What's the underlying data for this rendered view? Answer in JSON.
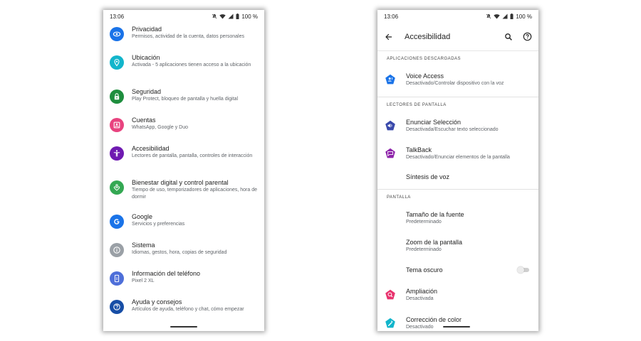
{
  "left_phone": {
    "status": {
      "time": "13:06",
      "battery": "100 %"
    },
    "items": [
      {
        "title": "Privacidad",
        "summary": "Permisos, actividad de la cuenta, datos personales",
        "color": "#1a73e8",
        "icon": "eye-icon"
      },
      {
        "title": "Ubicación",
        "summary": "Activada - 5 aplicaciones tienen acceso a la ubicación",
        "color": "#12b5cb",
        "icon": "location-pin-icon"
      },
      {
        "title": "Seguridad",
        "summary": "Play Protect, bloqueo de pantalla y huella digital",
        "color": "#1e8e3e",
        "icon": "lock-icon"
      },
      {
        "title": "Cuentas",
        "summary": "WhatsApp, Google y Duo",
        "color": "#e8437f",
        "icon": "account-card-icon"
      },
      {
        "title": "Accesibilidad",
        "summary": "Lectores de pantalla, pantalla, controles de interacción",
        "color": "#6f1ab1",
        "icon": "accessibility-person-icon"
      },
      {
        "title": "Bienestar digital y control parental",
        "summary": "Tiempo de uso, temporizadores de aplicaciones, hora de dormir",
        "color": "#34a853",
        "icon": "wellbeing-heart-icon"
      },
      {
        "title": "Google",
        "summary": "Servicios y preferencias",
        "color": "#1a73e8",
        "icon": "google-g-icon"
      },
      {
        "title": "Sistema",
        "summary": "Idiomas, gestos, hora, copias de seguridad",
        "color": "#9aa0a6",
        "icon": "info-icon"
      },
      {
        "title": "Información del teléfono",
        "summary": "Pixel 2 XL",
        "color": "#4e6fd9",
        "icon": "phone-info-icon"
      },
      {
        "title": "Ayuda y consejos",
        "summary": "Artículos de ayuda, teléfono y chat, cómo empezar",
        "color": "#174ea6",
        "icon": "help-icon"
      }
    ]
  },
  "right_phone": {
    "status": {
      "time": "13:06",
      "battery": "100 %"
    },
    "app_bar": {
      "title": "Accesibilidad",
      "back_icon": "arrow-back-icon",
      "search_icon": "search-icon",
      "help_icon": "help-icon"
    },
    "sections": {
      "downloaded": {
        "header": "APLICACIONES DESCARGADAS",
        "items": [
          {
            "title": "Voice Access",
            "summary": "Desactivado/Controlar dispositivo con la voz",
            "color": "#1a73e8",
            "icon": "voice-access-icon"
          }
        ]
      },
      "readers": {
        "header": "LECTORES DE PANTALLA",
        "items": [
          {
            "title": "Enunciar Selección",
            "summary": "Desactivada/Escuchar texto seleccionado",
            "color": "#3949ab",
            "icon": "speaker-icon"
          },
          {
            "title": "TalkBack",
            "summary": "Desactivado/Enunciar elementos de la pantalla",
            "color": "#8e24aa",
            "icon": "talkback-icon"
          },
          {
            "title": "Síntesis de voz"
          }
        ]
      },
      "display": {
        "header": "PANTALLA",
        "items": [
          {
            "title": "Tamaño de la fuente",
            "summary": "Predeterminado"
          },
          {
            "title": "Zoom de la pantalla",
            "summary": "Predeterminado"
          },
          {
            "title": "Tema oscuro",
            "toggle_on": false
          },
          {
            "title": "Ampliación",
            "summary": "Desactivada",
            "color": "#e8336e",
            "icon": "magnify-icon"
          },
          {
            "title": "Corrección de color",
            "summary": "Desactivado",
            "color": "#12b5cb",
            "icon": "color-correction-icon"
          }
        ]
      }
    }
  }
}
